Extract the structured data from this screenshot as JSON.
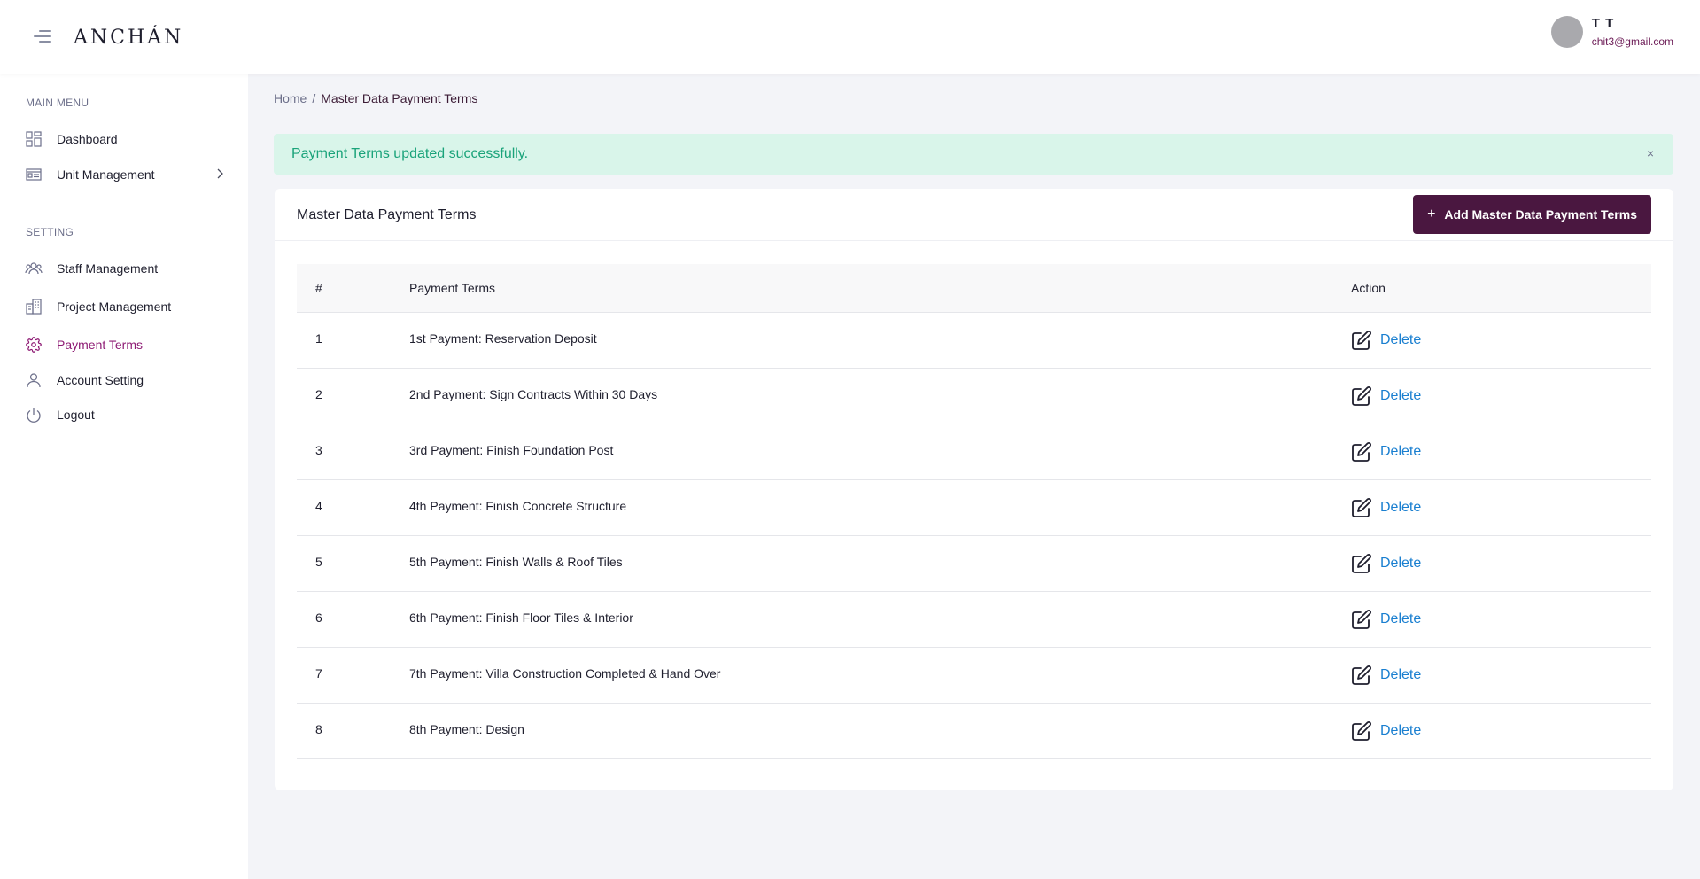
{
  "header": {
    "logo": "ANCHÁN",
    "user": {
      "name": "T T",
      "email": "chit3@gmail.com"
    }
  },
  "sidebar": {
    "sections": [
      {
        "label": "MAIN MENU"
      },
      {
        "label": "SETTING"
      }
    ],
    "items": [
      {
        "label": "Dashboard",
        "icon": "dashboard-icon"
      },
      {
        "label": "Unit Management",
        "icon": "unit-icon"
      },
      {
        "label": "Staff Management",
        "icon": "staff-icon"
      },
      {
        "label": "Project Management",
        "icon": "building-icon"
      },
      {
        "label": "Payment Terms",
        "icon": "gear-icon",
        "active": true
      },
      {
        "label": "Account Setting",
        "icon": "user-icon"
      },
      {
        "label": "Logout",
        "icon": "power-icon"
      }
    ]
  },
  "breadcrumb": {
    "home": "Home",
    "separator": "/",
    "current": "Master Data Payment Terms"
  },
  "alert": {
    "text": "Payment Terms updated successfully.",
    "close": "×"
  },
  "card": {
    "title": "Master Data Payment Terms",
    "add_button": "Add Master Data Payment Terms",
    "add_button_icon": "+"
  },
  "table": {
    "headers": [
      "#",
      "Payment Terms",
      "Action"
    ],
    "rows": [
      {
        "num": "1",
        "term": "1st  Payment:  Reservation Deposit",
        "action": "Delete"
      },
      {
        "num": "2",
        "term": "2nd Payment: Sign Contracts Within 30 Days",
        "action": "Delete"
      },
      {
        "num": "3",
        "term": "3rd Payment: Finish Foundation Post",
        "action": "Delete"
      },
      {
        "num": "4",
        "term": "4th Payment: Finish Concrete Structure",
        "action": "Delete"
      },
      {
        "num": "5",
        "term": "5th Payment: Finish Walls & Roof Tiles",
        "action": "Delete"
      },
      {
        "num": "6",
        "term": "6th Payment: Finish Floor Tiles & Interior",
        "action": "Delete"
      },
      {
        "num": "7",
        "term": "7th Payment: Villa Construction Completed & Hand Over",
        "action": "Delete"
      },
      {
        "num": "8",
        "term": "8th Payment: Design",
        "action": "Delete"
      }
    ]
  },
  "colors": {
    "primary": "#4a1740",
    "active": "#8e1b74",
    "success_bg": "#d9f5ea",
    "success_text": "#1aa37a",
    "link": "#1a7fd0"
  }
}
